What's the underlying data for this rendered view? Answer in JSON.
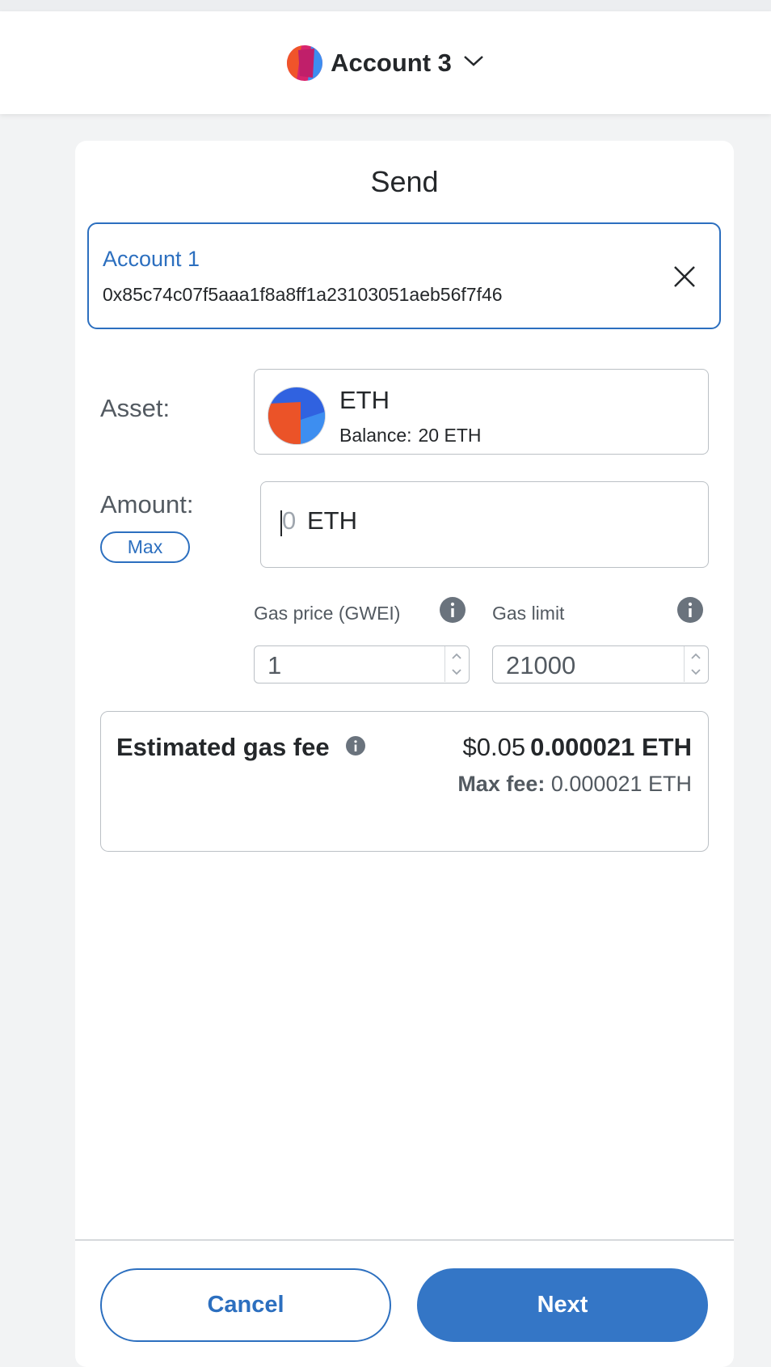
{
  "header": {
    "account_name": "Account 3",
    "avatar_icon": "account-jazzicon",
    "chevron_icon": "chevron-down-icon"
  },
  "send": {
    "title": "Send",
    "recipient": {
      "name": "Account 1",
      "address": "0x85c74c07f5aaa1f8a8ff1a23103051aeb56f7f46",
      "clear_icon": "close-icon"
    },
    "asset": {
      "label": "Asset:",
      "symbol": "ETH",
      "balance_label": "Balance:",
      "balance_value": "20 ETH",
      "icon": "eth-jazzicon"
    },
    "amount": {
      "label": "Amount:",
      "max_label": "Max",
      "value": "0",
      "unit": "ETH"
    },
    "gas_price": {
      "label": "Gas price (GWEI)",
      "value": "1"
    },
    "gas_limit": {
      "label": "Gas limit",
      "value": "21000"
    },
    "estimated_fee": {
      "title": "Estimated gas fee",
      "fiat": "$0.05",
      "eth": "0.000021 ETH",
      "max_fee_label": "Max fee:",
      "max_fee_value": "0.000021 ETH"
    }
  },
  "footer": {
    "cancel_label": "Cancel",
    "next_label": "Next"
  },
  "colors": {
    "accent": "#2c6fbf",
    "primary_button": "#3476c6",
    "border": "#bbc0c5",
    "text": "#24272a",
    "muted_text": "#535a61"
  }
}
